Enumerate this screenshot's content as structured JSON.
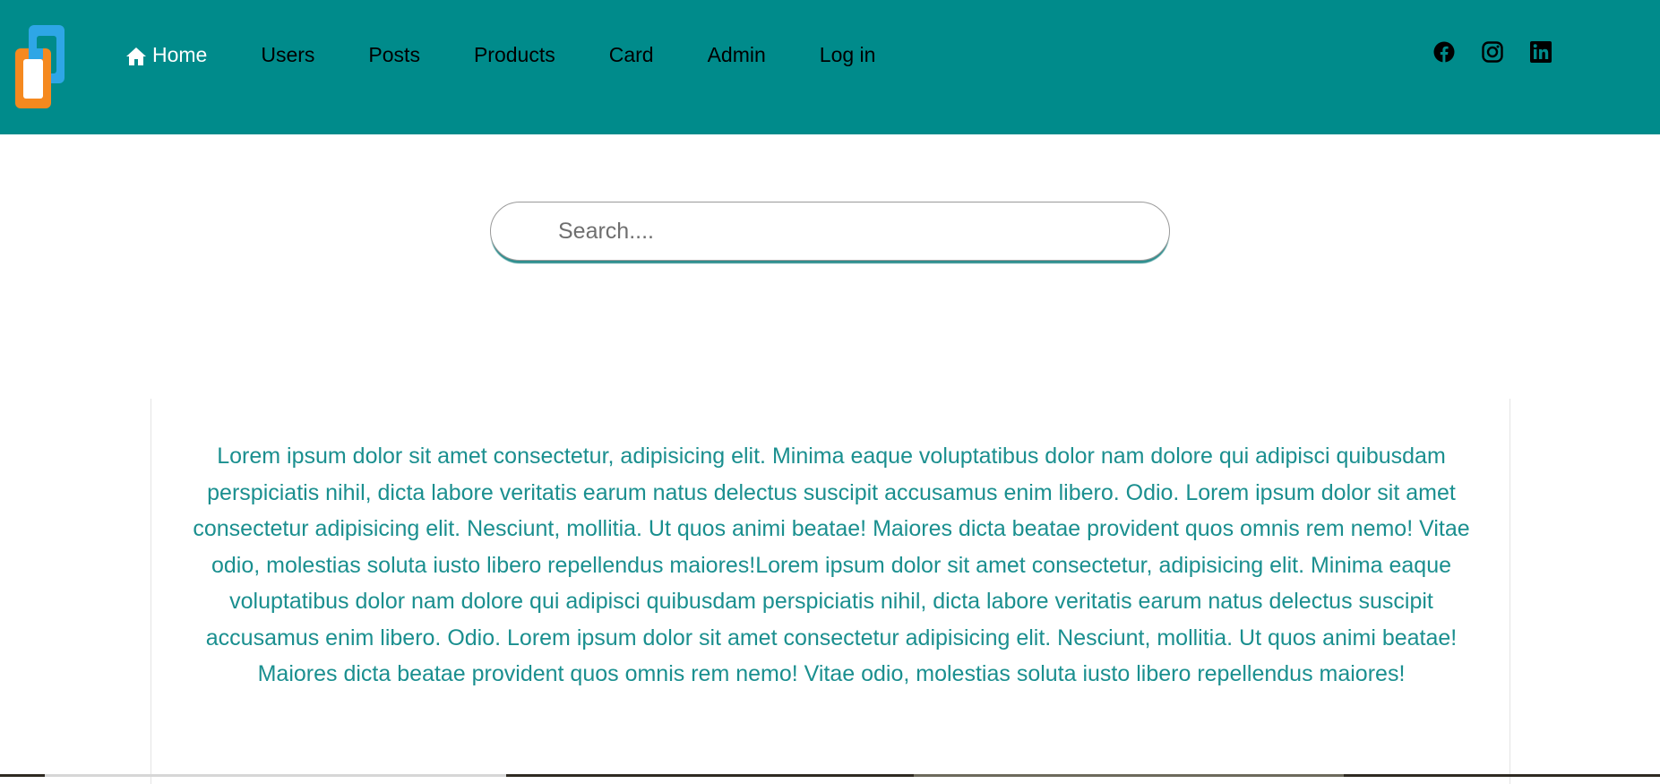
{
  "app": {
    "logo_icon": "vscode-style-interlocked-squares-icon",
    "colors": {
      "navbar": "#008b8b",
      "logo_blue": "#2ea6e6",
      "logo_orange": "#f5891f",
      "text_accent": "#1a8f8f"
    }
  },
  "nav": {
    "items": [
      {
        "label": "Home",
        "icon": "home-icon",
        "active": true
      },
      {
        "label": "Users"
      },
      {
        "label": "Posts"
      },
      {
        "label": "Products"
      },
      {
        "label": "Card"
      },
      {
        "label": "Admin"
      },
      {
        "label": "Log in"
      }
    ],
    "socials": [
      "facebook-icon",
      "instagram-icon",
      "linkedin-icon"
    ]
  },
  "search": {
    "placeholder": "Search....",
    "value": ""
  },
  "content": {
    "paragraph": "Lorem ipsum dolor sit amet consectetur, adipisicing elit. Minima eaque voluptatibus dolor nam dolore qui adipisci quibusdam perspiciatis nihil, dicta labore veritatis earum natus delectus suscipit accusamus enim libero. Odio. Lorem ipsum dolor sit amet consectetur adipisicing elit. Nesciunt, mollitia. Ut quos animi beatae! Maiores dicta beatae provident quos omnis rem nemo! Vitae odio, molestias soluta iusto libero repellendus maiores!Lorem ipsum dolor sit amet consectetur, adipisicing elit. Minima eaque voluptatibus dolor nam dolore qui adipisci quibusdam perspiciatis nihil, dicta labore veritatis earum natus delectus suscipit accusamus enim libero. Odio. Lorem ipsum dolor sit amet consectetur adipisicing elit. Nesciunt, mollitia. Ut quos animi beatae! Maiores dicta beatae provident quos omnis rem nemo! Vitae odio, molestias soluta iusto libero repellendus maiores!"
  }
}
